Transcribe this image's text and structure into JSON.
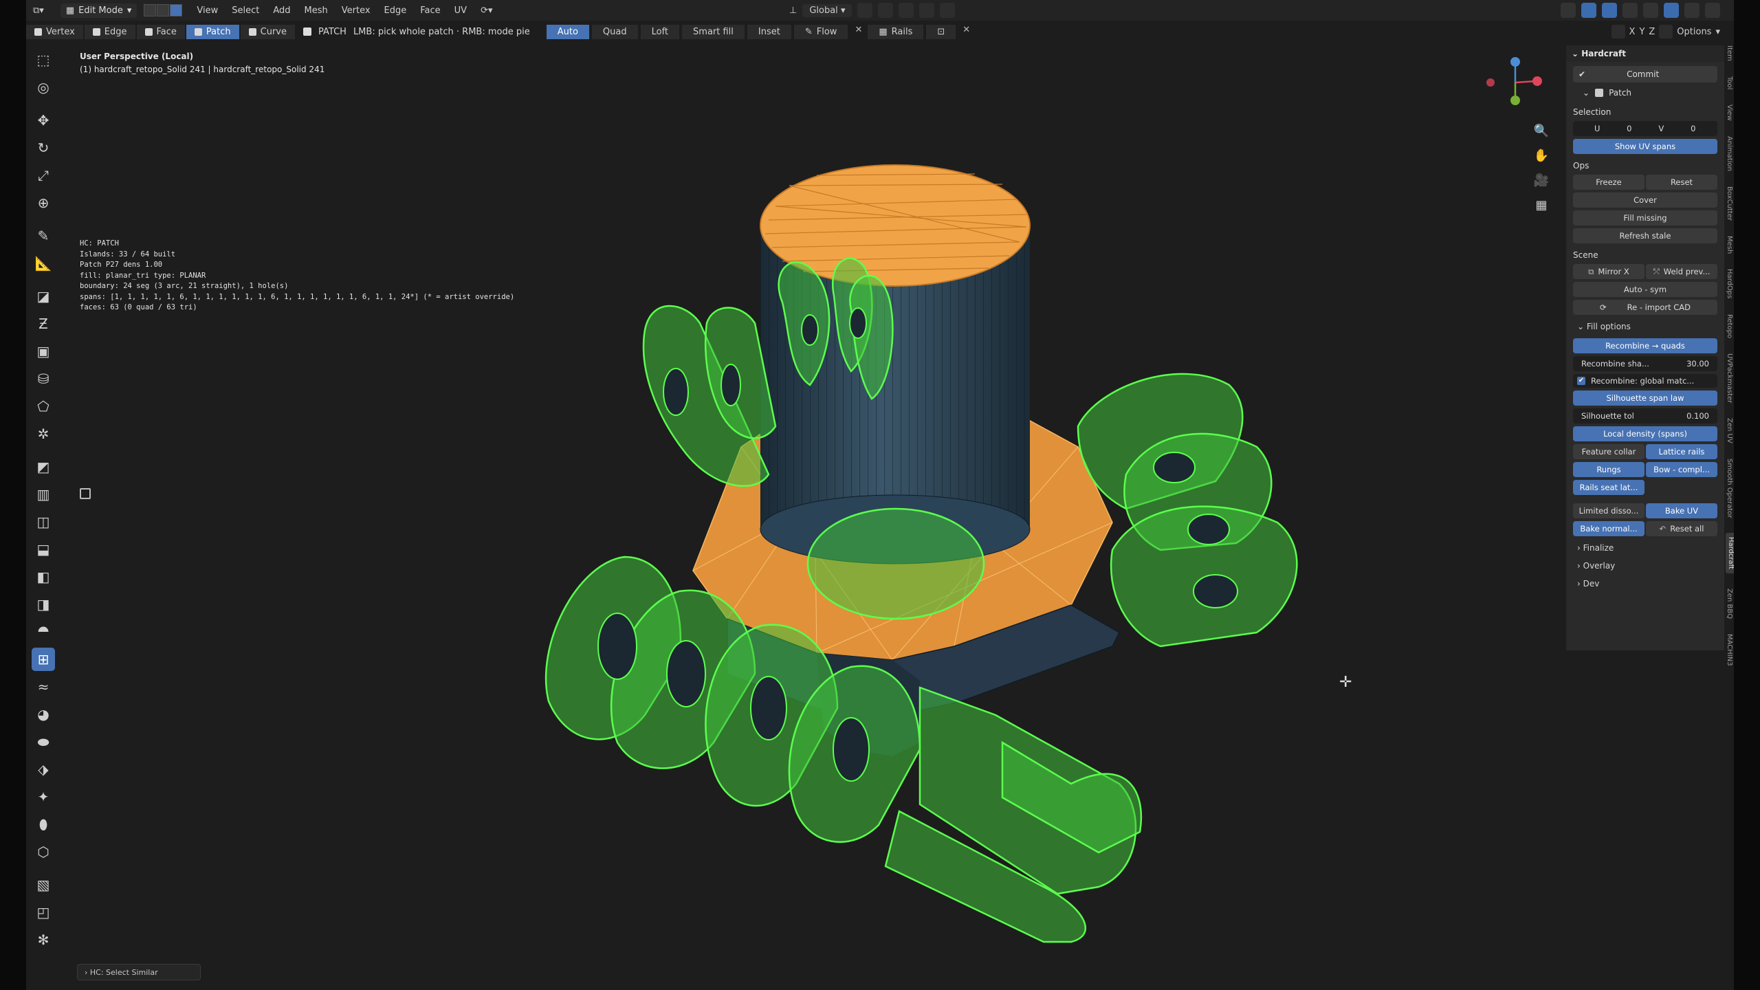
{
  "header": {
    "mode": "Edit Mode",
    "menu": [
      "View",
      "Select",
      "Add",
      "Mesh",
      "Vertex",
      "Edge",
      "Face",
      "UV"
    ],
    "transform_orientation": "Global",
    "options_label": "Options"
  },
  "tool_header": {
    "vertex": "Vertex",
    "edge": "Edge",
    "face": "Face",
    "patch": "Patch",
    "curve": "Curve",
    "patch_label": "PATCH",
    "hint": "LMB: pick whole patch · RMB: mode pie",
    "modes": [
      "Auto",
      "Quad",
      "Loft",
      "Smart fill",
      "Inset"
    ],
    "flow": "Flow",
    "rails": "Rails"
  },
  "viewport": {
    "title": "User Perspective (Local)",
    "object": "(1) hardcraft_retopo_Solid 241 | hardcraft_retopo_Solid 241",
    "hc_info": [
      "HC: PATCH",
      "Islands: 33 / 64 built",
      "Patch P27  dens 1.00",
      "  fill: planar_tri  type: PLANAR",
      "  boundary: 24 seg (3 arc, 21 straight), 1 hole(s)",
      "  spans: [1, 1, 1, 1, 1, 6, 1, 1, 1, 1, 1, 1, 6, 1, 1, 1, 1, 1, 1, 6, 1, 1, 24*]  (* = artist override)",
      "  faces: 63  (0 quad / 63 tri)"
    ],
    "last_operation": "HC: Select Similar"
  },
  "panel": {
    "title": "Hardcraft",
    "commit": "Commit",
    "patch": "Patch",
    "selection_label": "Selection",
    "uv": {
      "u_label": "U",
      "u_value": "0",
      "v_label": "V",
      "v_value": "0"
    },
    "show_uv_spans": "Show UV spans",
    "ops_label": "Ops",
    "freeze": "Freeze",
    "reset": "Reset",
    "cover": "Cover",
    "fill_missing": "Fill missing",
    "refresh_stale": "Refresh stale",
    "scene_label": "Scene",
    "mirror_x": "Mirror X",
    "weld_prev": "Weld prev...",
    "auto_sym": "Auto - sym",
    "reimport_cad": "Re - import CAD",
    "fill_options": "Fill options",
    "recombine_quads": "Recombine → quads",
    "recombine_sharp_label": "Recombine sha...",
    "recombine_sharp_value": "30.00",
    "recombine_global": "Recombine: global matc...",
    "silhouette_span_law": "Silhouette span law",
    "silhouette_tol_label": "Silhouette tol",
    "silhouette_tol_value": "0.100",
    "local_density": "Local density (spans)",
    "feature_collar": "Feature collar",
    "lattice_rails": "Lattice rails",
    "rungs": "Rungs",
    "bow_compl": "Bow - compl...",
    "rails_seat": "Rails seat lat...",
    "limited_disso": "Limited disso...",
    "bake_uv": "Bake UV",
    "bake_normal": "Bake normal...",
    "reset_all": "Reset all",
    "finalize": "Finalize",
    "overlay": "Overlay",
    "dev": "Dev"
  },
  "side_tabs": [
    "Item",
    "Tool",
    "View",
    "Animation",
    "BoxCutter",
    "Mesh",
    "HardOps",
    "Retopo",
    "UVPackmaster",
    "Zen UV",
    "Smooth Operator",
    "Hardcraft",
    "Zen BBQ",
    "MACHIN3"
  ],
  "colors": {
    "accent": "#4772b3",
    "orange_faces": "#e89a3a",
    "green_wire": "#46e63c",
    "mesh_body": "#2c3f4d"
  }
}
